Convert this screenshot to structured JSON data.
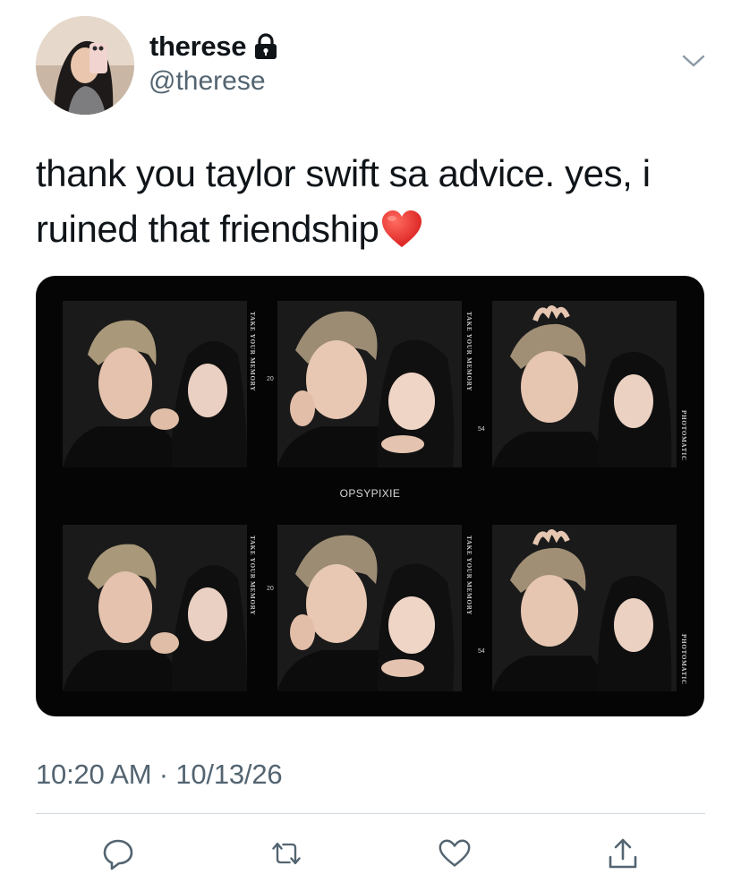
{
  "tweet": {
    "author": {
      "display_name": "therese",
      "handle": "@therese",
      "protected": true
    },
    "text": "thank you taylor swift sa advice. yes, i ruined that friendship",
    "emoji": "red-heart",
    "timestamp": "10:20 AM · 10/13/26",
    "media": {
      "brand_label": "OPSYPIXIE",
      "strip_label_top": "TAKE YOUR MEMORY",
      "strip_label_bottom": "TAKE YOUR MEMORY",
      "side_label": "PHOTOMATIC",
      "frame_numbers": [
        "20",
        "54"
      ]
    },
    "actions": [
      "reply-icon",
      "retweet-icon",
      "like-icon",
      "share-icon"
    ]
  }
}
